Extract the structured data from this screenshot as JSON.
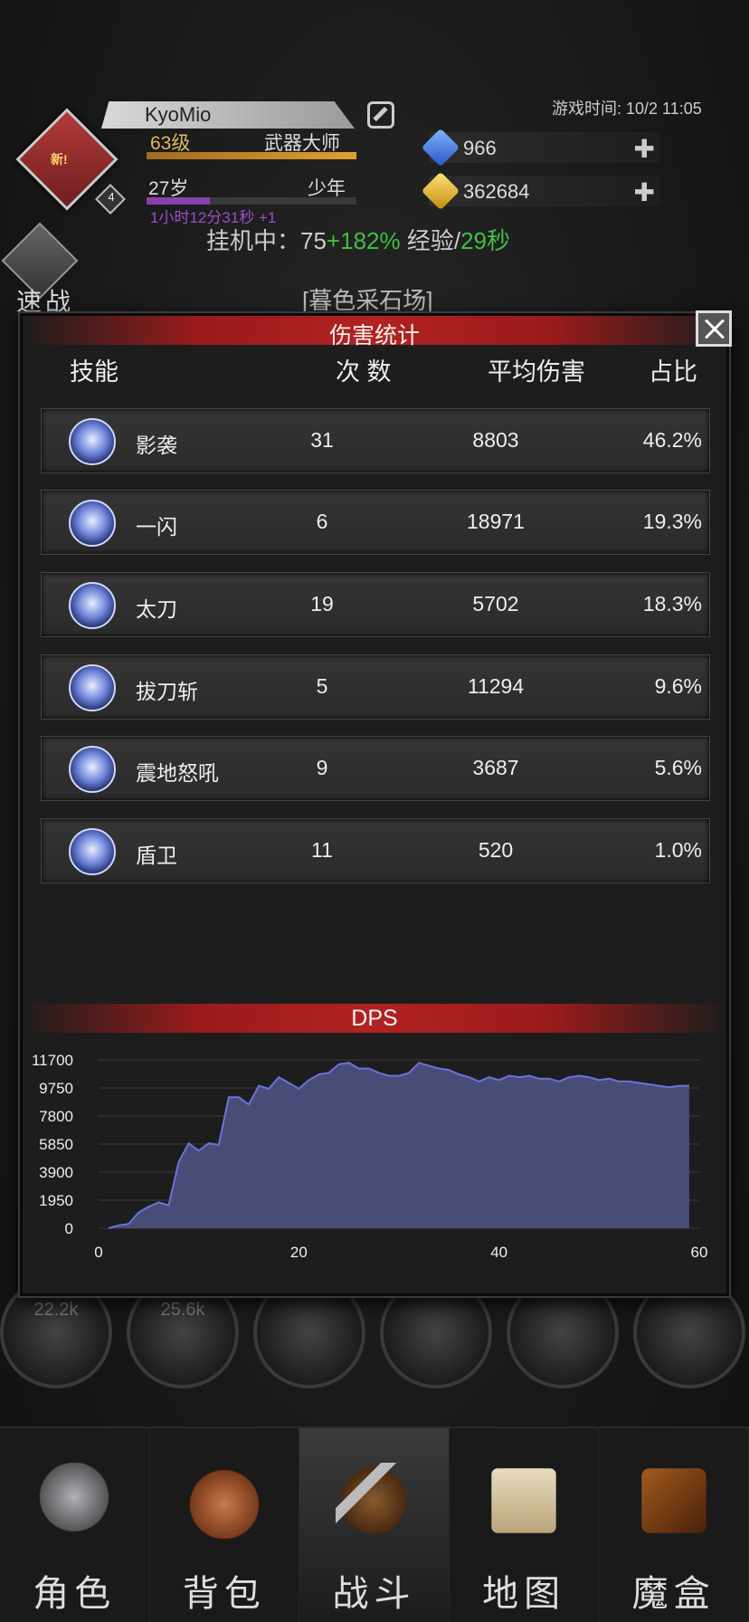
{
  "header": {
    "player_name": "KyoMio",
    "new_tag": "新!",
    "avatar_level": "4",
    "level": "63级",
    "class": "武器大师",
    "age": "27岁",
    "age_stage": "少年",
    "age_timer": "1小时12分31秒 +1",
    "game_time": "游戏时间: 10/2 11:05",
    "resources": [
      {
        "icon": "blue-gem-icon",
        "value": "966"
      },
      {
        "icon": "gold-gem-icon",
        "value": "362684"
      }
    ],
    "afk_prefix": "挂机中：75",
    "afk_bonus": "+182%",
    "afk_exp_label": " 经验/",
    "afk_exp_time": "29秒",
    "quick_battle": "速战",
    "location": "[暮色采石场]"
  },
  "modal": {
    "title": "伤害统计",
    "columns": {
      "skill": "技能",
      "count": "次 数",
      "avg": "平均伤害",
      "pct": "占比"
    },
    "rows": [
      {
        "icon": "shadow-strike-icon",
        "name": "影袭",
        "count": "31",
        "avg": "8803",
        "pct": "46.2%"
      },
      {
        "icon": "flash-icon",
        "name": "一闪",
        "count": "6",
        "avg": "18971",
        "pct": "19.3%"
      },
      {
        "icon": "katana-icon",
        "name": "太刀",
        "count": "19",
        "avg": "5702",
        "pct": "18.3%"
      },
      {
        "icon": "iaido-icon",
        "name": "拔刀斩",
        "count": "5",
        "avg": "11294",
        "pct": "9.6%"
      },
      {
        "icon": "roar-icon",
        "name": "震地怒吼",
        "count": "9",
        "avg": "3687",
        "pct": "5.6%"
      },
      {
        "icon": "shield-guard-icon",
        "name": "盾卫",
        "count": "11",
        "avg": "520",
        "pct": "1.0%"
      }
    ],
    "dps_title": "DPS"
  },
  "chart_data": {
    "type": "area",
    "title": "DPS",
    "xlim": [
      0,
      60
    ],
    "ylim": [
      0,
      11700
    ],
    "x_ticks": [
      0,
      20,
      40,
      60
    ],
    "y_ticks": [
      0,
      1950,
      3900,
      5850,
      7800,
      9750,
      11700
    ],
    "color": "#4a4c78",
    "line_color": "#6a73d8",
    "x": [
      1,
      2,
      3,
      4,
      5,
      6,
      7,
      8,
      9,
      10,
      11,
      12,
      13,
      14,
      15,
      16,
      17,
      18,
      19,
      20,
      21,
      22,
      23,
      24,
      25,
      26,
      27,
      28,
      29,
      30,
      31,
      32,
      33,
      34,
      35,
      36,
      37,
      38,
      39,
      40,
      41,
      42,
      43,
      44,
      45,
      46,
      47,
      48,
      49,
      50,
      51,
      52,
      53,
      54,
      55,
      56,
      57,
      58,
      59
    ],
    "y": [
      0,
      200,
      300,
      1100,
      1500,
      1800,
      1600,
      4600,
      5900,
      5400,
      5900,
      5800,
      9100,
      9100,
      8600,
      9900,
      9700,
      10500,
      10100,
      9700,
      10300,
      10700,
      10800,
      11400,
      11500,
      11100,
      11100,
      10800,
      10600,
      10600,
      10800,
      11500,
      11300,
      11100,
      11000,
      10700,
      10500,
      10200,
      10500,
      10300,
      10600,
      10500,
      10600,
      10400,
      10400,
      10200,
      10500,
      10600,
      10500,
      10300,
      10400,
      10200,
      10200,
      10100,
      10000,
      9900,
      9800,
      9900,
      9900
    ]
  },
  "nav": [
    {
      "label": "角色",
      "icon": "helmet-icon"
    },
    {
      "label": "背包",
      "icon": "backpack-icon"
    },
    {
      "label": "战斗",
      "icon": "sword-shield-icon"
    },
    {
      "label": "地图",
      "icon": "scroll-map-icon"
    },
    {
      "label": "魔盒",
      "icon": "magic-box-icon"
    }
  ],
  "bottom_circles": [
    "22.2k",
    "25.6k",
    "",
    "",
    "",
    ""
  ]
}
